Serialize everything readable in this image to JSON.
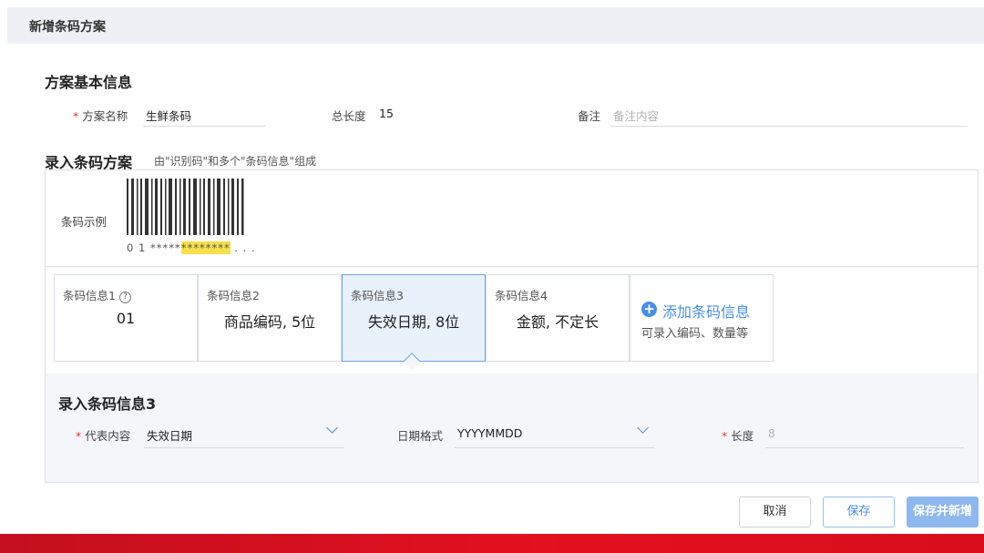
{
  "header": {
    "title": "新增条码方案"
  },
  "basic": {
    "title": "方案基本信息",
    "name_label": "方案名称",
    "name_value": "生鲜条码",
    "length_label": "总长度",
    "length_value": "15",
    "note_label": "备注",
    "note_placeholder": "备注内容",
    "required_mark": "*"
  },
  "scheme": {
    "title": "录入条码方案",
    "subtitle": "由\"识别码\"和多个\"条码信息\"组成",
    "example_label": "条码示例",
    "digits_prefix": "0 1 *****",
    "digits_highlight": "********",
    "digits_suffix": " . . .",
    "cards": [
      {
        "title": "条码信息1",
        "value": "01"
      },
      {
        "title": "条码信息2",
        "value": "商品编码, 5位"
      },
      {
        "title": "条码信息3",
        "value": "失效日期, 8位"
      },
      {
        "title": "条码信息4",
        "value": "金额, 不定长"
      }
    ],
    "help_glyph": "?",
    "add_card": {
      "icon": "+",
      "label": "添加条码信息",
      "sub": "可录入编码、数量等"
    }
  },
  "detail": {
    "title": "录入条码信息3",
    "content_label": "代表内容",
    "content_value": "失效日期",
    "date_format_label": "日期格式",
    "date_format_value": "YYYYMMDD",
    "length_label": "长度",
    "length_placeholder": "8"
  },
  "buttons": {
    "cancel": "取消",
    "save": "保存",
    "save_new": "保存并新增"
  },
  "colors": {
    "accent": "#4a8ee6",
    "required": "#e0393e",
    "highlight": "#f7e04a",
    "footer_bar": "#d80e1c"
  }
}
